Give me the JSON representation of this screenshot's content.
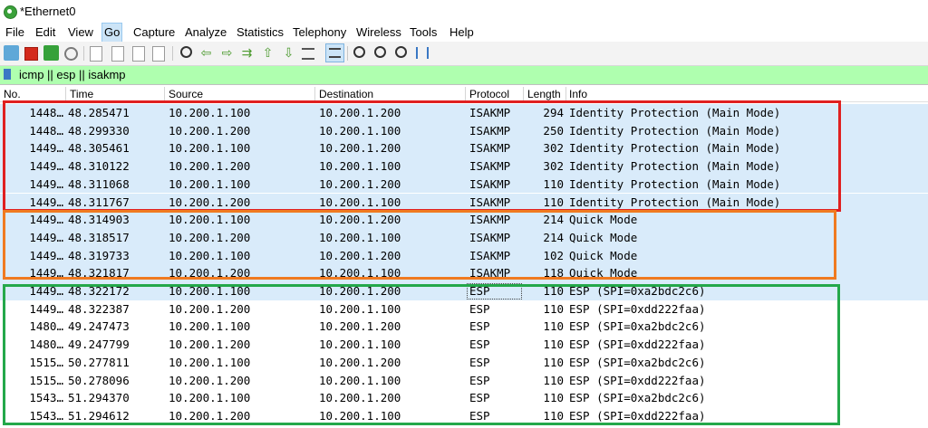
{
  "window": {
    "title": "*Ethernet0"
  },
  "menu": [
    "File",
    "Edit",
    "View",
    "Go",
    "Capture",
    "Analyze",
    "Statistics",
    "Telephony",
    "Wireless",
    "Tools",
    "Help"
  ],
  "toolbar_icons": [
    "shark-fin-start-icon",
    "stop-capture-icon",
    "restart-capture-icon",
    "capture-options-icon",
    "open-file-icon",
    "save-file-icon",
    "close-file-icon",
    "reload-file-icon",
    "find-packet-icon",
    "go-back-icon",
    "go-forward-icon",
    "go-to-packet-icon",
    "go-first-icon",
    "go-last-icon",
    "autoscroll-icon",
    "colorize-icon",
    "zoom-in-icon",
    "zoom-out-icon",
    "zoom-normal-icon",
    "resize-columns-icon"
  ],
  "filter": {
    "text": "icmp || esp || isakmp"
  },
  "columns": [
    "No.",
    "Time",
    "Source",
    "Destination",
    "Protocol",
    "Length",
    "Info"
  ],
  "packets": [
    {
      "no": "1448…",
      "time": "48.285471",
      "src": "10.200.1.100",
      "dst": "10.200.1.200",
      "proto": "ISAKMP",
      "len": "294",
      "info": "Identity Protection (Main Mode)"
    },
    {
      "no": "1448…",
      "time": "48.299330",
      "src": "10.200.1.200",
      "dst": "10.200.1.100",
      "proto": "ISAKMP",
      "len": "250",
      "info": "Identity Protection (Main Mode)"
    },
    {
      "no": "1449…",
      "time": "48.305461",
      "src": "10.200.1.100",
      "dst": "10.200.1.200",
      "proto": "ISAKMP",
      "len": "302",
      "info": "Identity Protection (Main Mode)"
    },
    {
      "no": "1449…",
      "time": "48.310122",
      "src": "10.200.1.200",
      "dst": "10.200.1.100",
      "proto": "ISAKMP",
      "len": "302",
      "info": "Identity Protection (Main Mode)"
    },
    {
      "no": "1449…",
      "time": "48.311068",
      "src": "10.200.1.100",
      "dst": "10.200.1.200",
      "proto": "ISAKMP",
      "len": "110",
      "info": "Identity Protection (Main Mode)"
    },
    {
      "no": "1449…",
      "time": "48.311767",
      "src": "10.200.1.200",
      "dst": "10.200.1.100",
      "proto": "ISAKMP",
      "len": "110",
      "info": "Identity Protection (Main Mode)"
    },
    {
      "no": "1449…",
      "time": "48.314903",
      "src": "10.200.1.100",
      "dst": "10.200.1.200",
      "proto": "ISAKMP",
      "len": "214",
      "info": "Quick Mode"
    },
    {
      "no": "1449…",
      "time": "48.318517",
      "src": "10.200.1.200",
      "dst": "10.200.1.100",
      "proto": "ISAKMP",
      "len": "214",
      "info": "Quick Mode"
    },
    {
      "no": "1449…",
      "time": "48.319733",
      "src": "10.200.1.100",
      "dst": "10.200.1.200",
      "proto": "ISAKMP",
      "len": "102",
      "info": "Quick Mode"
    },
    {
      "no": "1449…",
      "time": "48.321817",
      "src": "10.200.1.200",
      "dst": "10.200.1.100",
      "proto": "ISAKMP",
      "len": "118",
      "info": "Quick Mode"
    },
    {
      "no": "1449…",
      "time": "48.322172",
      "src": "10.200.1.100",
      "dst": "10.200.1.200",
      "proto": "ESP",
      "len": "110",
      "info": "ESP (SPI=0xa2bdc2c6)"
    },
    {
      "no": "1449…",
      "time": "48.322387",
      "src": "10.200.1.200",
      "dst": "10.200.1.100",
      "proto": "ESP",
      "len": "110",
      "info": "ESP (SPI=0xdd222faa)"
    },
    {
      "no": "1480…",
      "time": "49.247473",
      "src": "10.200.1.100",
      "dst": "10.200.1.200",
      "proto": "ESP",
      "len": "110",
      "info": "ESP (SPI=0xa2bdc2c6)"
    },
    {
      "no": "1480…",
      "time": "49.247799",
      "src": "10.200.1.200",
      "dst": "10.200.1.100",
      "proto": "ESP",
      "len": "110",
      "info": "ESP (SPI=0xdd222faa)"
    },
    {
      "no": "1515…",
      "time": "50.277811",
      "src": "10.200.1.100",
      "dst": "10.200.1.200",
      "proto": "ESP",
      "len": "110",
      "info": "ESP (SPI=0xa2bdc2c6)"
    },
    {
      "no": "1515…",
      "time": "50.278096",
      "src": "10.200.1.200",
      "dst": "10.200.1.100",
      "proto": "ESP",
      "len": "110",
      "info": "ESP (SPI=0xdd222faa)"
    },
    {
      "no": "1543…",
      "time": "51.294370",
      "src": "10.200.1.100",
      "dst": "10.200.1.200",
      "proto": "ESP",
      "len": "110",
      "info": "ESP (SPI=0xa2bdc2c6)"
    },
    {
      "no": "1543…",
      "time": "51.294612",
      "src": "10.200.1.200",
      "dst": "10.200.1.100",
      "proto": "ESP",
      "len": "110",
      "info": "ESP (SPI=0xdd222faa)"
    }
  ],
  "colors": {
    "isakmp_row": "#d9ebfa",
    "filter_ok": "#afffaf",
    "box_main_mode": "#e02020",
    "box_quick_mode": "#f07a20",
    "box_esp": "#24a84a"
  }
}
